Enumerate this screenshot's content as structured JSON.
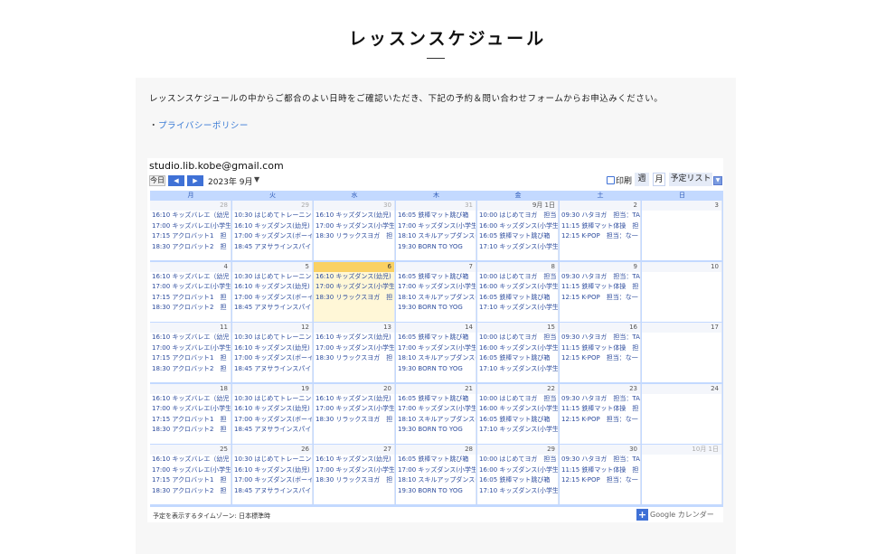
{
  "page": {
    "title": "レッスンスケジュール",
    "intro": "レッスンスケジュールの中からご都合のよい日時をご確認いただき、下記の予約＆問い合わせフォームからお申込みください。",
    "privacy_bullet": "・",
    "privacy_link": "プライバシーポリシー"
  },
  "calendar": {
    "title": "studio.lib.kobe@gmail.com",
    "today_label": "今日",
    "prev_icon": "◀",
    "next_icon": "▶",
    "month_label": "2023年 9月",
    "month_dropdown": "▼",
    "print_label": "印刷",
    "tabs": {
      "week": "週",
      "month": "月",
      "agenda": "予定リスト"
    },
    "agenda_dropdown": "▼",
    "weekdays": [
      "月",
      "火",
      "水",
      "木",
      "金",
      "土",
      "日"
    ],
    "weeks": [
      {
        "days": [
          {
            "num": "28",
            "other": true,
            "events": [
              "16:10 キッズバレエ（幼児",
              "17:00 キッズバレエ(小学生",
              "17:15 アクロバット1　担",
              "18:30 アクロバット2　担"
            ]
          },
          {
            "num": "29",
            "other": true,
            "events": [
              "10:30 はじめてトレーニング",
              "16:10 キッズダンス(幼児)",
              "17:00 キッズダンス(ボーイ",
              "18:45 アヌサラインスパイ"
            ]
          },
          {
            "num": "30",
            "other": true,
            "events": [
              "16:10 キッズダンス(幼児)",
              "17:00 キッズダンス(小学生",
              "18:30 リラックスヨガ　担"
            ]
          },
          {
            "num": "31",
            "other": true,
            "events": [
              "16:05 鉄棒マット跳び箱",
              "17:00 キッズダンス(小学生",
              "18:10 スキルアップダンス(",
              "19:30 BORN TO YOG"
            ]
          },
          {
            "num": "9月 1日",
            "other": false,
            "events": [
              "10:00 はじめてヨガ　担当",
              "16:00 キッズダンス(小学生",
              "16:05 鉄棒マット跳び箱",
              "17:10 キッズダンス(小学生"
            ]
          },
          {
            "num": "2",
            "other": false,
            "events": [
              "09:30 ハタヨガ　担当：TA",
              "11:15 鉄棒マット体操　担",
              "12:15 K-POP　担当：な一"
            ]
          },
          {
            "num": "3",
            "other": false,
            "events": []
          }
        ]
      },
      {
        "days": [
          {
            "num": "4",
            "other": false,
            "events": [
              "16:10 キッズバレエ（幼児",
              "17:00 キッズバレエ(小学生",
              "17:15 アクロバット1　担",
              "18:30 アクロバット2　担"
            ]
          },
          {
            "num": "5",
            "other": false,
            "events": [
              "10:30 はじめてトレーニング",
              "16:10 キッズダンス(幼児)",
              "17:00 キッズダンス(ボーイ",
              "18:45 アヌサラインスパイ"
            ]
          },
          {
            "num": "6",
            "other": false,
            "today": true,
            "events": [
              "16:10 キッズダンス(幼児)",
              "17:00 キッズダンス(小学生",
              "18:30 リラックスヨガ　担"
            ]
          },
          {
            "num": "7",
            "other": false,
            "events": [
              "16:05 鉄棒マット跳び箱",
              "17:00 キッズダンス(小学生",
              "18:10 スキルアップダンス(",
              "19:30 BORN TO YOG"
            ]
          },
          {
            "num": "8",
            "other": false,
            "events": [
              "10:00 はじめてヨガ　担当",
              "16:00 キッズダンス(小学生",
              "16:05 鉄棒マット跳び箱",
              "17:10 キッズダンス(小学生"
            ]
          },
          {
            "num": "9",
            "other": false,
            "events": [
              "09:30 ハタヨガ　担当：TA",
              "11:15 鉄棒マット体操　担",
              "12:15 K-POP　担当：な一"
            ]
          },
          {
            "num": "10",
            "other": false,
            "events": []
          }
        ]
      },
      {
        "days": [
          {
            "num": "11",
            "other": false,
            "events": [
              "16:10 キッズバレエ（幼児",
              "17:00 キッズバレエ(小学生",
              "17:15 アクロバット1　担",
              "18:30 アクロバット2　担"
            ]
          },
          {
            "num": "12",
            "other": false,
            "events": [
              "10:30 はじめてトレーニング",
              "16:10 キッズダンス(幼児)",
              "17:00 キッズダンス(ボーイ",
              "18:45 アヌサラインスパイ"
            ]
          },
          {
            "num": "13",
            "other": false,
            "events": [
              "16:10 キッズダンス(幼児)",
              "17:00 キッズダンス(小学生",
              "18:30 リラックスヨガ　担"
            ]
          },
          {
            "num": "14",
            "other": false,
            "events": [
              "16:05 鉄棒マット跳び箱",
              "17:00 キッズダンス(小学生",
              "18:10 スキルアップダンス(",
              "19:30 BORN TO YOG"
            ]
          },
          {
            "num": "15",
            "other": false,
            "events": [
              "10:00 はじめてヨガ　担当",
              "16:00 キッズダンス(小学生",
              "16:05 鉄棒マット跳び箱",
              "17:10 キッズダンス(小学生"
            ]
          },
          {
            "num": "16",
            "other": false,
            "events": [
              "09:30 ハタヨガ　担当：TA",
              "11:15 鉄棒マット体操　担",
              "12:15 K-POP　担当：な一"
            ]
          },
          {
            "num": "17",
            "other": false,
            "events": []
          }
        ]
      },
      {
        "days": [
          {
            "num": "18",
            "other": false,
            "events": [
              "16:10 キッズバレエ（幼児",
              "17:00 キッズバレエ(小学生",
              "17:15 アクロバット1　担",
              "18:30 アクロバット2　担"
            ]
          },
          {
            "num": "19",
            "other": false,
            "events": [
              "10:30 はじめてトレーニング",
              "16:10 キッズダンス(幼児)",
              "17:00 キッズダンス(ボーイ",
              "18:45 アヌサラインスパイ"
            ]
          },
          {
            "num": "20",
            "other": false,
            "events": [
              "16:10 キッズダンス(幼児)",
              "17:00 キッズダンス(小学生",
              "18:30 リラックスヨガ　担"
            ]
          },
          {
            "num": "21",
            "other": false,
            "events": [
              "16:05 鉄棒マット跳び箱",
              "17:00 キッズダンス(小学生",
              "18:10 スキルアップダンス(",
              "19:30 BORN TO YOG"
            ]
          },
          {
            "num": "22",
            "other": false,
            "events": [
              "10:00 はじめてヨガ　担当",
              "16:00 キッズダンス(小学生",
              "16:05 鉄棒マット跳び箱",
              "17:10 キッズダンス(小学生"
            ]
          },
          {
            "num": "23",
            "other": false,
            "events": [
              "09:30 ハタヨガ　担当：TA",
              "11:15 鉄棒マット体操　担",
              "12:15 K-POP　担当：な一"
            ]
          },
          {
            "num": "24",
            "other": false,
            "events": []
          }
        ]
      },
      {
        "days": [
          {
            "num": "25",
            "other": false,
            "events": [
              "16:10 キッズバレエ（幼児",
              "17:00 キッズバレエ(小学生",
              "17:15 アクロバット1　担",
              "18:30 アクロバット2　担"
            ]
          },
          {
            "num": "26",
            "other": false,
            "events": [
              "10:30 はじめてトレーニング",
              "16:10 キッズダンス(幼児)",
              "17:00 キッズダンス(ボーイ",
              "18:45 アヌサラインスパイ"
            ]
          },
          {
            "num": "27",
            "other": false,
            "events": [
              "16:10 キッズダンス(幼児)",
              "17:00 キッズダンス(小学生",
              "18:30 リラックスヨガ　担"
            ]
          },
          {
            "num": "28",
            "other": false,
            "events": [
              "16:05 鉄棒マット跳び箱",
              "17:00 キッズダンス(小学生",
              "18:10 スキルアップダンス(",
              "19:30 BORN TO YOG"
            ]
          },
          {
            "num": "29",
            "other": false,
            "events": [
              "10:00 はじめてヨガ　担当",
              "16:00 キッズダンス(小学生",
              "16:05 鉄棒マット跳び箱",
              "17:10 キッズダンス(小学生"
            ]
          },
          {
            "num": "30",
            "other": false,
            "events": [
              "09:30 ハタヨガ　担当：TA",
              "11:15 鉄棒マット体操　担",
              "12:15 K-POP　担当：な一"
            ]
          },
          {
            "num": "10月 1日",
            "other": true,
            "events": []
          }
        ]
      }
    ],
    "timezone_label": "予定を表示するタイムゾーン: 日本標準時",
    "google_calendar_label": "Google カレンダー",
    "google_plus_icon": "+",
    "colors": {
      "accent": "#3f71d6",
      "grid": "#c3d9ff",
      "today": "#fff7d7",
      "event_text": "#2e4d9e"
    }
  }
}
